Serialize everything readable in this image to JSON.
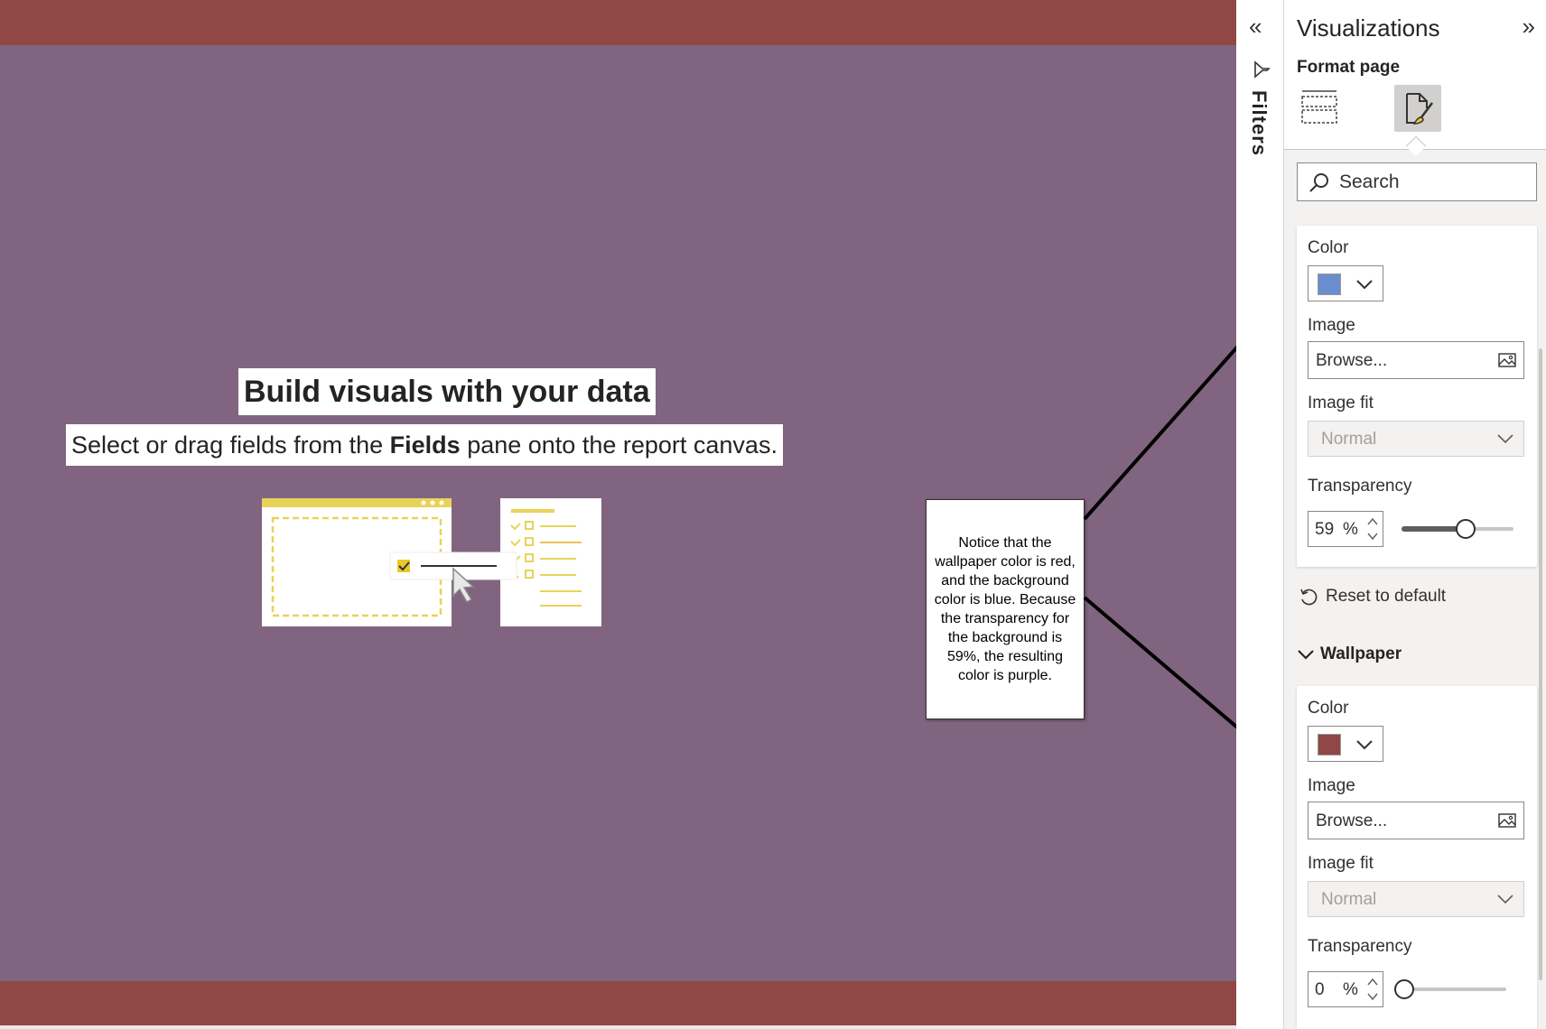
{
  "canvas": {
    "wallpaper_color": "#8f4845",
    "page_color": "#816480",
    "empty_state": {
      "title": "Build visuals with your data",
      "subtitle_before": "Select or drag fields from the ",
      "subtitle_bold": "Fields",
      "subtitle_after": " pane onto the report canvas."
    }
  },
  "callout": {
    "text": "Notice that the wallpaper color is red, and the background color is blue. Because the transparency for the background is 59%, the resulting color is purple."
  },
  "filters_rail": {
    "label": "Filters",
    "collapse_icon": "double-chevron-left-icon",
    "filter_icon": "funnel-icon"
  },
  "visualizations": {
    "title": "Visualizations",
    "expand_icon": "double-chevron-right-icon",
    "subtitle": "Format page",
    "tabs": [
      {
        "name": "fields-tab",
        "icon": "grid-layout-icon",
        "selected": false
      },
      {
        "name": "format-tab",
        "icon": "paintbrush-page-icon",
        "selected": true
      }
    ],
    "search": {
      "placeholder": "Search"
    },
    "background": {
      "color_label": "Color",
      "color_value": "#6a8dce",
      "image_label": "Image",
      "browse_label": "Browse...",
      "image_fit_label": "Image fit",
      "image_fit_value": "Normal",
      "transparency_label": "Transparency",
      "transparency_value": "59",
      "transparency_unit": "%",
      "transparency_fraction": 0.59
    },
    "reset_label": "Reset to default",
    "wallpaper": {
      "section_title": "Wallpaper",
      "color_label": "Color",
      "color_value": "#8f4845",
      "image_label": "Image",
      "browse_label": "Browse...",
      "image_fit_label": "Image fit",
      "image_fit_value": "Normal",
      "transparency_label": "Transparency",
      "transparency_value": "0",
      "transparency_unit": "%",
      "transparency_fraction": 0
    }
  }
}
